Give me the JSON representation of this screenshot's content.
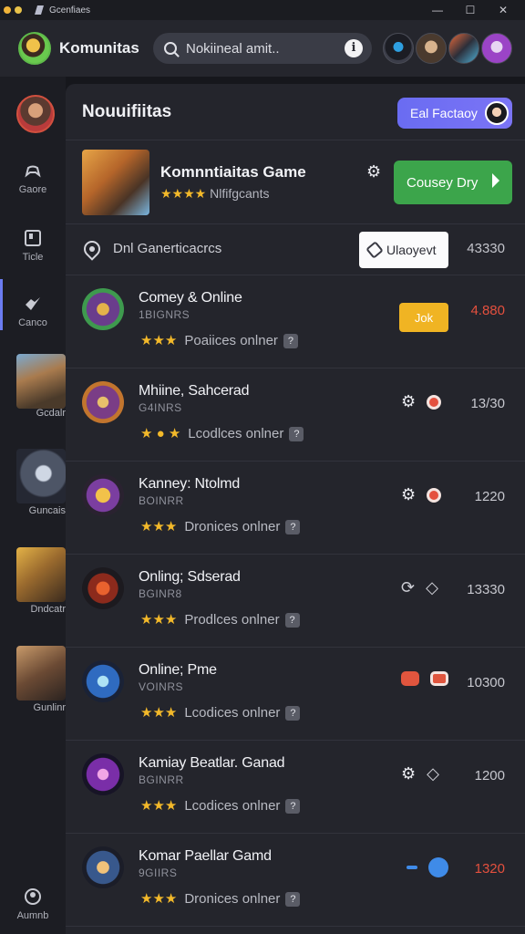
{
  "window": {
    "title": "Gcenfiaes",
    "controls": [
      "—",
      "☐",
      "✕"
    ]
  },
  "header": {
    "app_name": "Komunitas",
    "search_placeholder": "Nokiineal amit..",
    "info_icon": "i"
  },
  "sidebar": {
    "items": [
      {
        "label": "Gaore",
        "icon": "gamepad-icon"
      },
      {
        "label": "Ticle",
        "icon": "cards-icon"
      },
      {
        "label": "Canco",
        "icon": "sword-icon"
      }
    ],
    "thumbs": [
      {
        "label": "Gcdalr"
      },
      {
        "label": "Guncais"
      },
      {
        "label": "Dndcatr"
      },
      {
        "label": "Gunlinr"
      }
    ],
    "bottom_label": "Aumnb"
  },
  "panel": {
    "title": "Nouuifiitas",
    "action_label": "Eal Factaoy"
  },
  "featured": {
    "title": "Komnntiaitas Game",
    "stars": "★★★★",
    "rating_text": "Nlfifgcants",
    "button_label": "Cousey Dry"
  },
  "filter": {
    "text": "Dnl Ganerticacrcs",
    "update_label": "Ulaoyevt",
    "count": "43330"
  },
  "rows": [
    {
      "title": "Comey & Online",
      "sub": "1BIGNRS",
      "stars": "★★★",
      "rating_text": "Poaiices onlner",
      "count": "4.880",
      "action": "join",
      "join_label": "Jok"
    },
    {
      "title": "Mhiine, Sahcerad",
      "sub": "G4INRS",
      "stars": "★ ● ★",
      "rating_text": "Lcodlces onlner",
      "count": "13/30",
      "action": "gear-red"
    },
    {
      "title": "Kanney: Ntolmd",
      "sub": "BOINRR",
      "stars": "★★★",
      "rating_text": "Dronices onlner",
      "count": "1220",
      "action": "gear-red"
    },
    {
      "title": "Onling; Sdserad",
      "sub": "BGINR8",
      "stars": "★★★",
      "rating_text": "Prodlces onlner",
      "count": "13330",
      "action": "outline"
    },
    {
      "title": "Online; Pme",
      "sub": "VOINRS",
      "stars": "★★★",
      "rating_text": "Lcodices onlner",
      "count": "10300",
      "action": "red-pair"
    },
    {
      "title": "Kamiay Beatlar. Ganad",
      "sub": "BGINRR",
      "stars": "★★★",
      "rating_text": "Lcodices onlner",
      "count": "1200",
      "action": "gear-outline"
    },
    {
      "title": "Komar Paellar Gamd",
      "sub": "9GIIRS",
      "stars": "★★★",
      "rating_text": "Dronices onlner",
      "count": "1320",
      "action": "blue"
    }
  ],
  "colors": {
    "accent": "#6b7cf2",
    "primary_button": "#3ca54b",
    "warning_button": "#f0b423",
    "alert_count": "#e4503e"
  }
}
